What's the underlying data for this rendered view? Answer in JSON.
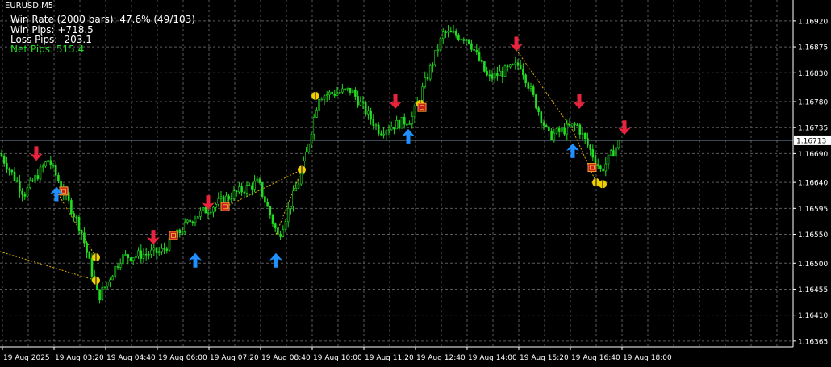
{
  "symbol_title": "EURUSD,M5",
  "stats": {
    "win_rate": "Win Rate (2000 bars): 47.6% (49/103)",
    "win_pips": "Win Pips: +718.5",
    "loss_pips": "Loss Pips: -203.1",
    "net_pips": "Net Pips: 515.4"
  },
  "colors": {
    "background": "#000000",
    "grid": "#5a5a5a",
    "candle": "#22dd22",
    "buy_arrow": "#1e90ff",
    "sell_arrow": "#e8233c",
    "exit_marker": "#f0d000",
    "stop_box": "#c82020",
    "trade_line": "#e0b000",
    "price_line": "#6f8fa8",
    "net_pips_text": "#22dd22",
    "axis_text": "#ffffff"
  },
  "chart_data": {
    "type": "candlestick",
    "symbol": "EURUSD",
    "timeframe": "M5",
    "current_price": "1.16713",
    "ylim": [
      1.16355,
      1.16945
    ],
    "price_ticks": [
      "1.16920",
      "1.16875",
      "1.16830",
      "1.16780",
      "1.16735",
      "1.16690",
      "1.16640",
      "1.16595",
      "1.16550",
      "1.16500",
      "1.16455",
      "1.16410",
      "1.16365"
    ],
    "time_ticks": [
      "19 Aug 2025",
      "19 Aug 03:20",
      "19 Aug 04:40",
      "19 Aug 06:00",
      "19 Aug 07:20",
      "19 Aug 08:40",
      "19 Aug 10:00",
      "19 Aug 11:20",
      "19 Aug 12:40",
      "19 Aug 14:00",
      "19 Aug 15:20",
      "19 Aug 16:40",
      "19 Aug 18:00"
    ],
    "approx_close_path": [
      {
        "t": 0,
        "p": 1.1669
      },
      {
        "t": 30,
        "p": 1.1662
      },
      {
        "t": 60,
        "p": 1.1668
      },
      {
        "t": 100,
        "p": 1.1656
      },
      {
        "t": 122,
        "p": 1.1644
      },
      {
        "t": 150,
        "p": 1.1651
      },
      {
        "t": 200,
        "p": 1.1652
      },
      {
        "t": 240,
        "p": 1.1658
      },
      {
        "t": 290,
        "p": 1.1662
      },
      {
        "t": 320,
        "p": 1.1664
      },
      {
        "t": 345,
        "p": 1.16545
      },
      {
        "t": 375,
        "p": 1.1666
      },
      {
        "t": 395,
        "p": 1.1679
      },
      {
        "t": 435,
        "p": 1.168
      },
      {
        "t": 470,
        "p": 1.1673
      },
      {
        "t": 510,
        "p": 1.1675
      },
      {
        "t": 550,
        "p": 1.169
      },
      {
        "t": 580,
        "p": 1.1689
      },
      {
        "t": 605,
        "p": 1.1682
      },
      {
        "t": 645,
        "p": 1.16845
      },
      {
        "t": 680,
        "p": 1.1672
      },
      {
        "t": 715,
        "p": 1.1674
      },
      {
        "t": 745,
        "p": 1.1666
      },
      {
        "t": 770,
        "p": 1.16715
      }
    ],
    "signals": [
      {
        "type": "sell",
        "t": 45,
        "p": 1.1669
      },
      {
        "type": "buy",
        "t": 70,
        "p": 1.1662
      },
      {
        "type": "buy",
        "t": 242,
        "p": 1.16505
      },
      {
        "type": "sell",
        "t": 190,
        "p": 1.16545
      },
      {
        "type": "sell",
        "t": 258,
        "p": 1.16605
      },
      {
        "type": "buy",
        "t": 342,
        "p": 1.16505
      },
      {
        "type": "sell",
        "t": 490,
        "p": 1.1678
      },
      {
        "type": "buy",
        "t": 506,
        "p": 1.1672
      },
      {
        "type": "sell",
        "t": 640,
        "p": 1.1688
      },
      {
        "type": "sell",
        "t": 718,
        "p": 1.1678
      },
      {
        "type": "buy",
        "t": 710,
        "p": 1.16695
      },
      {
        "type": "sell",
        "t": 774,
        "p": 1.16735
      }
    ],
    "exits": [
      {
        "kind": "circle",
        "t": 119,
        "p": 1.1651
      },
      {
        "kind": "circle",
        "t": 119,
        "p": 1.1647
      },
      {
        "kind": "circle",
        "t": 374,
        "p": 1.16662
      },
      {
        "kind": "circle",
        "t": 391,
        "p": 1.1679
      },
      {
        "kind": "circle",
        "t": 521,
        "p": 1.16776
      },
      {
        "kind": "circle",
        "t": 739,
        "p": 1.1664
      },
      {
        "kind": "circle",
        "t": 747,
        "p": 1.16637
      },
      {
        "kind": "box",
        "t": 79,
        "p": 1.16625
      },
      {
        "kind": "box",
        "t": 215,
        "p": 1.16548
      },
      {
        "kind": "box",
        "t": 279,
        "p": 1.16598
      },
      {
        "kind": "box",
        "t": 523,
        "p": 1.1677
      },
      {
        "kind": "box",
        "t": 734,
        "p": 1.16666
      }
    ],
    "trade_lines": [
      [
        {
          "t": 0,
          "p": 1.1652
        },
        {
          "t": 119,
          "p": 1.1647
        }
      ],
      [
        {
          "t": 70,
          "p": 1.16625
        },
        {
          "t": 119,
          "p": 1.1651
        }
      ],
      [
        {
          "t": 280,
          "p": 1.16598
        },
        {
          "t": 374,
          "p": 1.16662
        }
      ],
      [
        {
          "t": 342,
          "p": 1.1655
        },
        {
          "t": 374,
          "p": 1.16662
        }
      ],
      [
        {
          "t": 640,
          "p": 1.1687
        },
        {
          "t": 710,
          "p": 1.1673
        }
      ],
      [
        {
          "t": 710,
          "p": 1.1673
        },
        {
          "t": 739,
          "p": 1.1664
        }
      ]
    ]
  }
}
